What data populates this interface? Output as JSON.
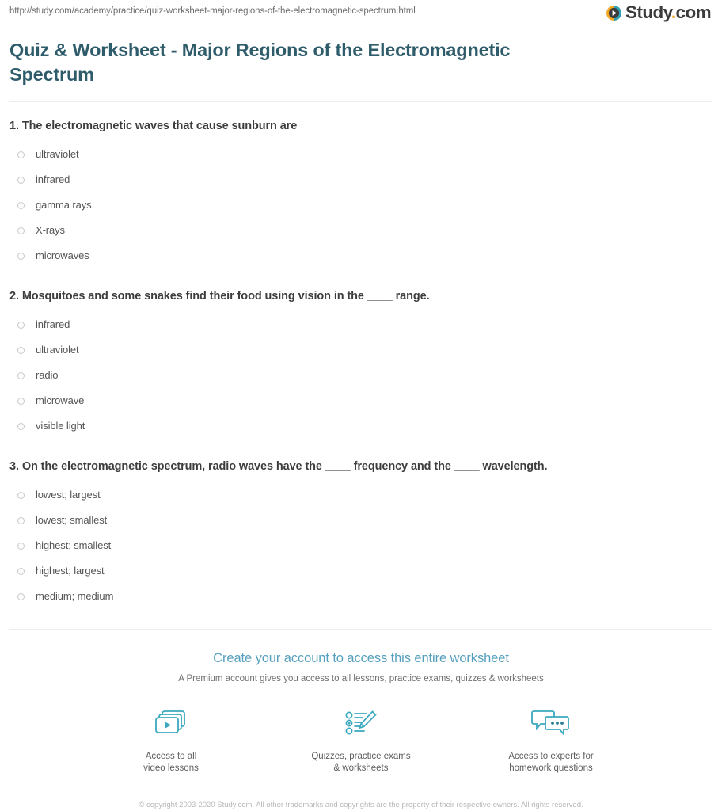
{
  "browser": {
    "url": "http://study.com/academy/practice/quiz-worksheet-major-regions-of-the-electromagnetic-spectrum.html"
  },
  "brand": {
    "name": "Study",
    "dot": ".",
    "tld": "com",
    "mark_icon": "play-circle-icon",
    "accent_orange": "#f5a623",
    "accent_teal": "#3aa8bf",
    "title_color": "#2f5c6b",
    "cta_color": "#56a0bd"
  },
  "page_title": "Quiz & Worksheet - Major Regions of the Electromagnetic Spectrum",
  "questions": [
    {
      "text": "1. The electromagnetic waves that cause sunburn are",
      "options": [
        "ultraviolet",
        "infrared",
        "gamma rays",
        "X-rays",
        "microwaves"
      ]
    },
    {
      "text": "2. Mosquitoes and some snakes find their food using vision in the ____ range.",
      "options": [
        "infrared",
        "ultraviolet",
        "radio",
        "microwave",
        "visible light"
      ]
    },
    {
      "text": "3. On the electromagnetic spectrum, radio waves have the ____ frequency and the ____ wavelength.",
      "options": [
        "lowest; largest",
        "lowest; smallest",
        "highest; smallest",
        "highest; largest",
        "medium; medium"
      ]
    }
  ],
  "cta": {
    "headline": "Create your account to access this entire worksheet",
    "subhead": "A Premium account gives you access to all lessons, practice exams, quizzes & worksheets",
    "perks": [
      {
        "icon": "video-play-icon",
        "label": "Access to all\nvideo lessons"
      },
      {
        "icon": "checklist-pencil-icon",
        "label": "Quizzes, practice exams\n& worksheets"
      },
      {
        "icon": "chat-bubbles-icon",
        "label": "Access to experts for\nhomework questions"
      }
    ]
  },
  "copyright": "© copyright 2003-2020 Study.com. All other trademarks and copyrights are the property of their respective owners. All rights reserved."
}
